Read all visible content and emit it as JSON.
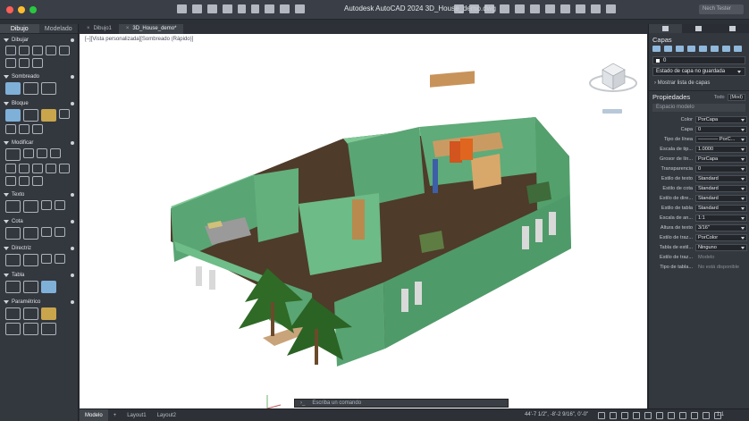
{
  "window": {
    "title": "Autodesk AutoCAD 2024    3D_House_demo.dwg",
    "user": "Nech Tester"
  },
  "left_palette": {
    "tabs": [
      "Dibujo",
      "Modelado"
    ],
    "sections": [
      "Dibujar",
      "Sombreado",
      "Bloque",
      "Modificar",
      "Texto",
      "Cota",
      "Directriz",
      "Tabla",
      "Paramétrico"
    ]
  },
  "doc_tabs": {
    "drawing1": "Dibujo1",
    "drawing2": "3D_House_demo*"
  },
  "viewport": {
    "label": "[–][Vista personalizada][Sombreado (Rápido)]"
  },
  "command_line": {
    "prompt": "Escriba un comando"
  },
  "status_bar": {
    "layouts": [
      "Modelo",
      "Layout1",
      "Layout2"
    ],
    "coords": "44'-7 1/2\", -8'-2 9/16\", 0'-0\"",
    "scale": "1:1"
  },
  "right_palette": {
    "layers_title": "Capas",
    "layer_current": "0",
    "layer_state": "Estado de capa no guardada",
    "show_list": "Mostrar lista de capas",
    "properties_title": "Propiedades",
    "properties_all": "Todo",
    "properties_mode": "(Mod)",
    "space": "Espacio modelo",
    "props": [
      {
        "label": "Color",
        "value": "PorCapa"
      },
      {
        "label": "Capa",
        "value": "0"
      },
      {
        "label": "Tipo de línea",
        "value": "———— PorC..."
      },
      {
        "label": "Escala de tip...",
        "value": "1.0000"
      },
      {
        "label": "Grosor de lín...",
        "value": "PorCapa"
      },
      {
        "label": "Transparencia",
        "value": "0"
      },
      {
        "label": "Estilo de texto",
        "value": "Standard"
      },
      {
        "label": "Estilo de cota",
        "value": "Standard"
      },
      {
        "label": "Estilo de dire...",
        "value": "Standard"
      },
      {
        "label": "Estilo de tabla",
        "value": "Standard"
      },
      {
        "label": "Escala de an...",
        "value": "1:1"
      },
      {
        "label": "Altura de texto",
        "value": "3/16\""
      },
      {
        "label": "Estilo de traz...",
        "value": "PorColor"
      },
      {
        "label": "Tabla de estil...",
        "value": "Ninguno"
      },
      {
        "label": "Estilo de traz...",
        "value": "Modelo"
      },
      {
        "label": "Tipo de tabla...",
        "value": "No está disponible"
      }
    ]
  },
  "colors": {
    "wall": "#5aa574",
    "floor": "#4e3b2a",
    "tree": "#2f6a26"
  }
}
